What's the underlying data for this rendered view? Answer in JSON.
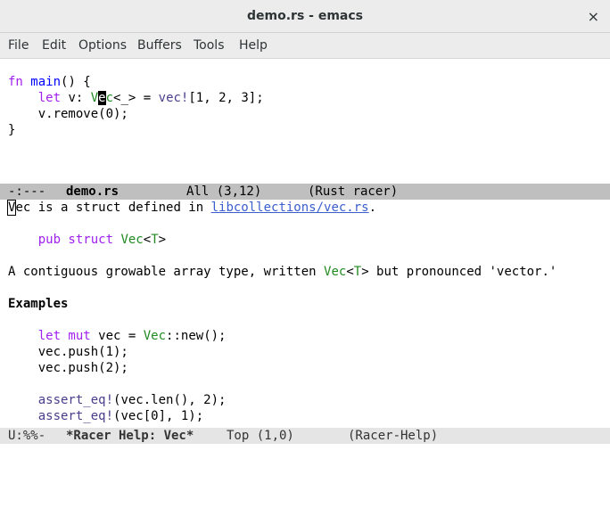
{
  "window": {
    "title": "demo.rs - emacs",
    "close_glyph": "×"
  },
  "menu": [
    "File",
    "Edit",
    "Options",
    "Buffers",
    "Tools",
    "Help"
  ],
  "editor": {
    "l1": {
      "kw": "fn",
      "name": "main",
      "rest": "() {"
    },
    "l2": {
      "indent": "    ",
      "kw": "let",
      "mid": " v: ",
      "ty_before": "V",
      "cursor": "e",
      "ty_after": "c",
      "generic": "<_>",
      "eq": " = ",
      "mac": "vec!",
      "rest": "[1, 2, 3];"
    },
    "l3": "    v.remove(0);",
    "l4": "}"
  },
  "modeline_top": {
    "status": "-:---",
    "buffer": "demo.rs",
    "position": "All (3,12)",
    "mode": "(Rust racer)"
  },
  "help": {
    "l1": {
      "cursor": "V",
      "text": "ec is a struct defined in ",
      "link": "libcollections/vec.rs",
      "end": "."
    },
    "l3": {
      "indent": "    ",
      "kw": "pub struct",
      "sp": " ",
      "ty": "Vec",
      "lt": "<",
      "tp": "T",
      "gt": ">"
    },
    "l5": {
      "pre": "A contiguous growable array type, written ",
      "ty": "Vec",
      "lt": "<",
      "tp": "T",
      "post": "> but pronounced 'vector.'"
    },
    "l7": "Examples",
    "l9": {
      "indent": "    ",
      "kw": "let mut",
      "mid": " vec = ",
      "ty": "Vec",
      "rest": "::new();"
    },
    "l10": "    vec.push(1);",
    "l11": "    vec.push(2);",
    "l13": {
      "indent": "    ",
      "mac": "assert_eq!",
      "rest": "(vec.len(), 2);"
    },
    "l14": {
      "indent": "    ",
      "mac": "assert_eq!",
      "rest": "(vec[0], 1);"
    }
  },
  "modeline_bottom": {
    "status": "U:%%-",
    "buffer": "*Racer Help: Vec*",
    "position": "Top (1,0)",
    "mode": "(Racer-Help)"
  }
}
